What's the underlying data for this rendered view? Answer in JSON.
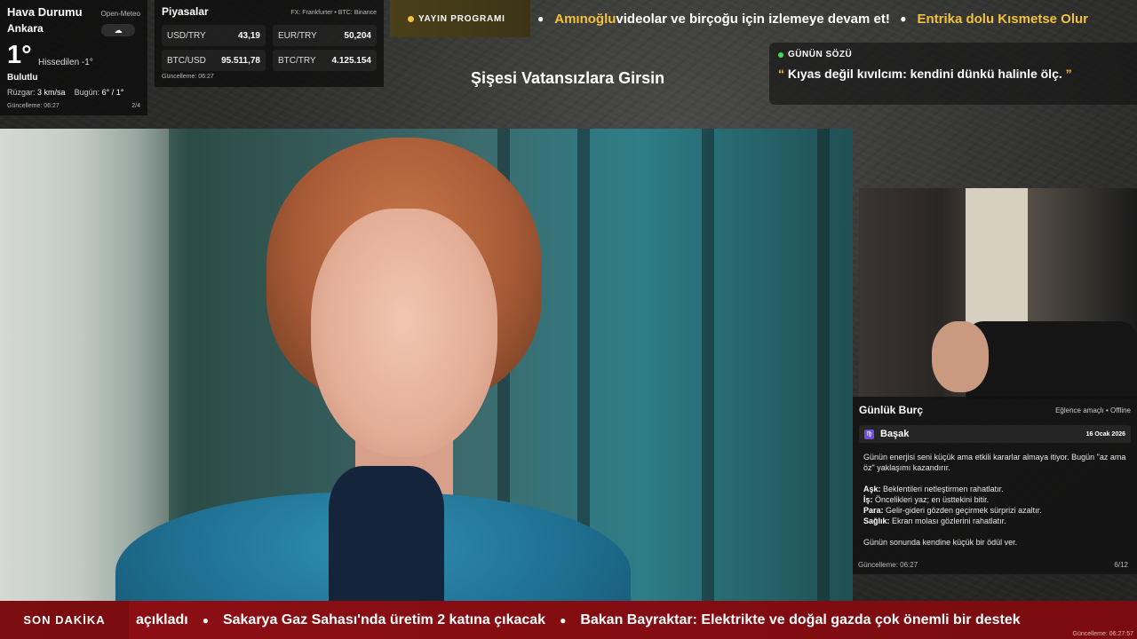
{
  "weather": {
    "title": "Hava Durumu",
    "source": "Open-Meteo",
    "city": "Ankara",
    "icon": "cloud-icon",
    "temperature": "1°",
    "feels_like": "Hissedilen -1°",
    "condition": "Bulutlu",
    "wind_label": "Rüzgar:",
    "wind_value": "3 km/sa",
    "today_label": "Bugün:",
    "today_value": "6° / 1°",
    "updated": "Güncelleme: 06:27",
    "page": "2/4"
  },
  "markets": {
    "title": "Piyasalar",
    "source": "FX: Frankfurter • BTC: Binance",
    "items": [
      {
        "label": "USD/TRY",
        "value": "43,19"
      },
      {
        "label": "EUR/TRY",
        "value": "50,204"
      },
      {
        "label": "BTC/USD",
        "value": "95.511,78"
      },
      {
        "label": "BTC/TRY",
        "value": "4.125.154"
      }
    ],
    "updated": "Güncelleme: 06:27"
  },
  "program": {
    "label": "YAYIN PROGRAMI",
    "ticker": [
      {
        "highlight": "Amınoğlu",
        "text": " videolar ve birçoğu için izlemeye devam et!"
      },
      {
        "highlight": "Entrika dolu Kısmetse Olur",
        "text": ""
      }
    ]
  },
  "show_title": "Şişesi Vatansızlara Girsin",
  "quote": {
    "label": "GÜNÜN SÖZÜ",
    "open": "“",
    "text": " Kıyas değil kıvılcım: kendini dünkü halinle ölç. ",
    "close": "”"
  },
  "horoscope": {
    "title": "Günlük Burç",
    "meta": "Eğlence amaçlı • Offline",
    "sign_icon": "♍",
    "sign": "Başak",
    "date": "16 Ocak 2026",
    "intro": "Günün enerjisi seni küçük ama etkili kararlar almaya itiyor. Bugün \"az ama öz\" yaklaşımı kazandırır.",
    "lines": [
      {
        "key": "Aşk:",
        "value": " Beklentileri netleştirmen rahatlatır."
      },
      {
        "key": "İş:",
        "value": " Öncelikleri yaz; en üsttekini bitir."
      },
      {
        "key": "Para:",
        "value": " Gelir-gideri gözden geçirmek sürprizi azaltır."
      },
      {
        "key": "Sağlık:",
        "value": " Ekran molası gözlerini rahatlatır."
      }
    ],
    "outro": "Günün sonunda kendine küçük bir ödül ver.",
    "updated": "Güncelleme: 06:27",
    "page": "6/12"
  },
  "news": {
    "label": "SON DAKİKA",
    "items": [
      "açıkladı",
      "Sakarya Gaz Sahası'nda üretim 2 katına çıkacak",
      "Bakan Bayraktar: Elektrikte ve doğal gazda çok önemli bir destek"
    ],
    "updated": "Güncelleme: 06:27:57"
  }
}
